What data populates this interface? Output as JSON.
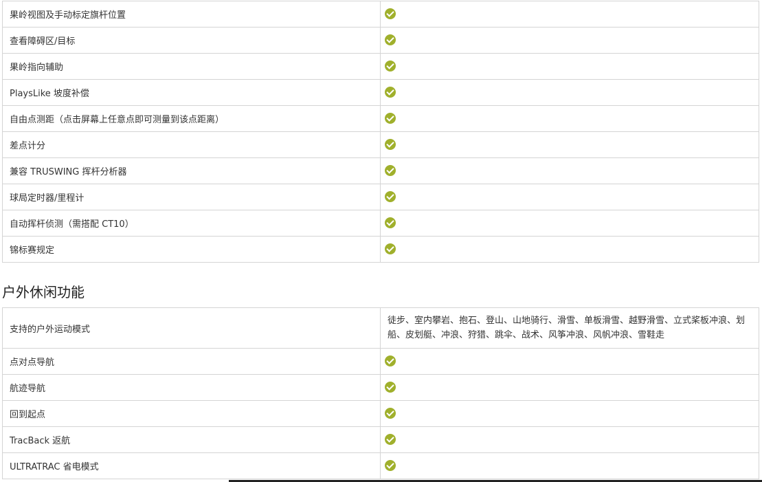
{
  "golf_features": {
    "rows": [
      {
        "label": "果岭视图及手动标定旗杆位置",
        "supported": true
      },
      {
        "label": "查看障碍区/目标",
        "supported": true
      },
      {
        "label": "果岭指向辅助",
        "supported": true
      },
      {
        "label": "PlaysLike 坡度补偿",
        "supported": true
      },
      {
        "label": "自由点测距（点击屏幕上任意点即可测量到该点距离）",
        "supported": true
      },
      {
        "label": "差点计分",
        "supported": true
      },
      {
        "label": "兼容 TRUSWING 挥杆分析器",
        "supported": true
      },
      {
        "label": "球局定时器/里程计",
        "supported": true
      },
      {
        "label": "自动挥杆侦测（需搭配 CT10）",
        "supported": true
      },
      {
        "label": "锦标赛规定",
        "supported": true
      }
    ]
  },
  "outdoor_section": {
    "title": "户外休闲功能",
    "modes_row": {
      "label": "支持的户外运动模式",
      "value": "徒步、室内攀岩、抱石、登山、山地骑行、滑雪、单板滑雪、越野滑雪、立式桨板冲浪、划船、皮划艇、冲浪、狩猎、跳伞、战术、风筝冲浪、风帆冲浪、雪鞋走"
    },
    "rows": [
      {
        "label": "点对点导航",
        "supported": true
      },
      {
        "label": "航迹导航",
        "supported": true
      },
      {
        "label": "回到起点",
        "supported": true
      },
      {
        "label": "TracBack 返航",
        "supported": true
      },
      {
        "label": "ULTRATRAC 省电模式",
        "supported": true
      }
    ]
  },
  "colors": {
    "check_icon": "#a0b02c",
    "border": "#d4d4d4",
    "text": "#333333"
  },
  "icons": {
    "check": "check-circle-icon"
  }
}
